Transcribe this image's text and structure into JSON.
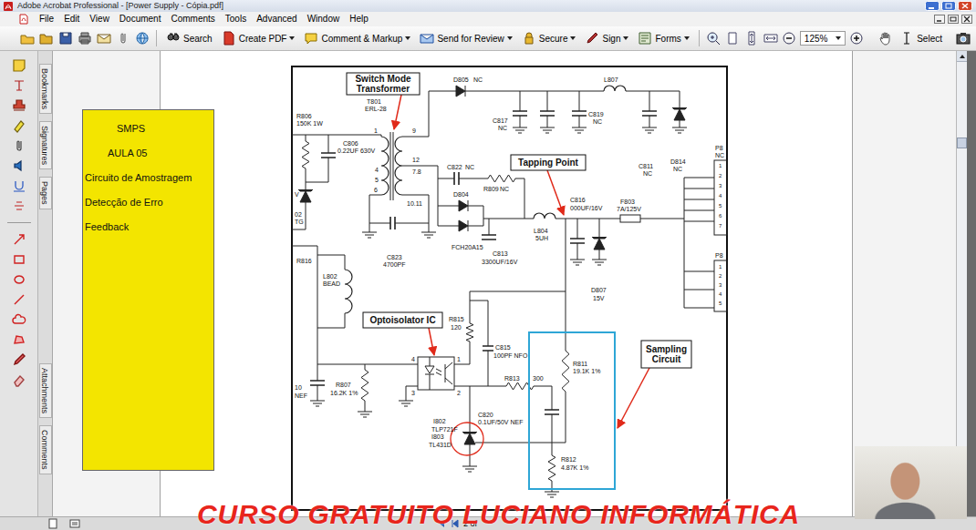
{
  "window": {
    "title": "Adobe Acrobat Professional - [Power Supply - Cópia.pdf]"
  },
  "menu": [
    "File",
    "Edit",
    "View",
    "Document",
    "Comments",
    "Tools",
    "Advanced",
    "Window",
    "Help"
  ],
  "toolbar": {
    "buttons": [
      {
        "label": "Search",
        "dropdown": false
      },
      {
        "label": "Create PDF",
        "dropdown": true
      },
      {
        "label": "Comment & Markup",
        "dropdown": true
      },
      {
        "label": "Send for Review",
        "dropdown": true
      },
      {
        "label": "Secure",
        "dropdown": true
      },
      {
        "label": "Sign",
        "dropdown": true
      },
      {
        "label": "Forms",
        "dropdown": true
      }
    ],
    "zoom": "125%",
    "select": "Select"
  },
  "side_tabs": [
    {
      "label": "Bookmarks",
      "selected": false
    },
    {
      "label": "Signatures",
      "selected": false
    },
    {
      "label": "Pages",
      "selected": false
    },
    {
      "label": "Attachments",
      "selected": false
    },
    {
      "label": "Comments",
      "selected": false
    }
  ],
  "slide_box": {
    "lines": [
      "SMPS",
      "AULA 05",
      "Circuito de Amostragem",
      "Detecção de Erro",
      "Feedback"
    ]
  },
  "schematic": {
    "callouts": [
      {
        "lines": [
          "Switch Mode",
          "Transformer"
        ]
      },
      {
        "lines": [
          "Tapping Point"
        ]
      },
      {
        "lines": [
          "Optoisolator IC"
        ]
      },
      {
        "lines": [
          "Sampling",
          "Circuit"
        ]
      }
    ],
    "components": [
      {
        "ref": "R806",
        "value": "150K 1W"
      },
      {
        "ref": "T801",
        "value": "ERL-28"
      },
      {
        "ref": "D805",
        "value": "NC"
      },
      {
        "ref": "L807"
      },
      {
        "ref": "C806",
        "value": "0.22UF 630V"
      },
      {
        "ref": "C817",
        "value": "NC"
      },
      {
        "ref": "C819",
        "value": "NC"
      },
      {
        "ref": "C811",
        "value": "NC"
      },
      {
        "ref": "D814",
        "value": "NC"
      },
      {
        "ref": "C822",
        "value": "NC"
      },
      {
        "ref": "R809",
        "value": "NC"
      },
      {
        "ref": "D804",
        "value": "FCH20A15"
      },
      {
        "ref": "L804",
        "value": "5UH"
      },
      {
        "ref": "C816",
        "value": "000UF/16V"
      },
      {
        "ref": "F803",
        "value": "7A/125V"
      },
      {
        "ref": "C813",
        "value": "3300UF/16V"
      },
      {
        "ref": "C823",
        "value": "4700PF"
      },
      {
        "ref": "R816"
      },
      {
        "ref": "L802",
        "value": "BEAD"
      },
      {
        "ref": "D807",
        "value": "15V"
      },
      {
        "ref": "R815",
        "value": "120"
      },
      {
        "ref": "C815",
        "value": "100PF NFO"
      },
      {
        "ref": "R811",
        "value": "19.1K 1%"
      },
      {
        "ref": "R813",
        "value": "300"
      },
      {
        "ref": "R807",
        "value": "16.2K 1%"
      },
      {
        "ref": "I802",
        "value": "TLP721F"
      },
      {
        "ref": "C820",
        "value": "0.1UF/50V NEF"
      },
      {
        "ref": "I803",
        "value": "TL431D"
      },
      {
        "ref": "R812",
        "value": "4.87K 1%"
      },
      {
        "ref": "P8",
        "value": "NC"
      },
      {
        "ref": "P8"
      },
      {
        "ref": "V"
      },
      {
        "ref": "02",
        "value": "TG"
      },
      {
        "ref": "10",
        "value": "NEF"
      }
    ],
    "transformer_pins": [
      "1",
      "9",
      "12",
      "7.8",
      "4",
      "5",
      "6",
      "10.11"
    ],
    "opto_pins": [
      "4",
      "3",
      "1",
      "2"
    ],
    "connector_pins": [
      [
        "1",
        "2",
        "3",
        "4",
        "5",
        "6",
        "7"
      ],
      [
        "1",
        "2",
        "3",
        "4",
        "5"
      ]
    ]
  },
  "scrollbar": {
    "level": 0.17
  },
  "status_bar": {
    "page": "2 of"
  },
  "watermark": "CURSO GRATUITO LUCIANO INFORMÁTICA"
}
